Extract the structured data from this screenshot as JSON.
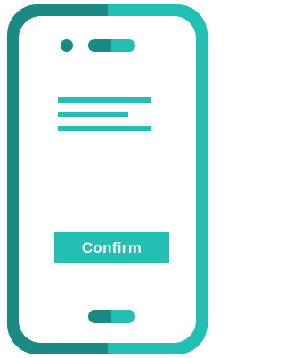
{
  "colors": {
    "dark_teal": "#1b8a85",
    "light_teal": "#24bfb3",
    "screen": "#ffffff"
  },
  "icons": {
    "phone": "smartphone-icon",
    "camera": "camera-dot-icon",
    "speaker": "speaker-slot-icon",
    "home_bar": "home-indicator-icon"
  },
  "content": {
    "lines": [
      "text-line",
      "text-line",
      "text-line"
    ]
  },
  "confirm_button": {
    "label": "Confirm"
  }
}
